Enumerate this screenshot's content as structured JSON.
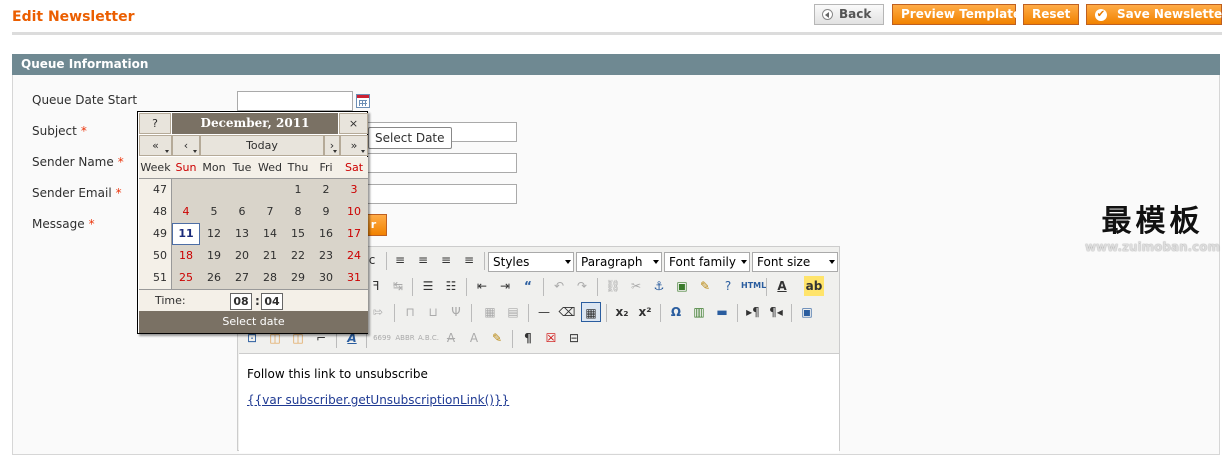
{
  "header": {
    "title": "Edit Newsletter",
    "back": "Back",
    "preview": "Preview Template",
    "reset": "Reset",
    "save": "Save Newsletter"
  },
  "section": {
    "title": "Queue Information"
  },
  "fields": {
    "queue_date_start": "Queue Date Start",
    "subject": "Subject",
    "sender_name": "Sender Name",
    "sender_email": "Sender Email",
    "message": "Message",
    "required_mark": "*"
  },
  "tooltip": "Select Date",
  "calendar": {
    "help": "?",
    "title": "December, 2011",
    "close": "×",
    "prev_year": "«",
    "prev_month": "‹",
    "today": "Today",
    "next_month": "›",
    "next_year": "»",
    "week_label": "Week",
    "days": [
      "Sun",
      "Mon",
      "Tue",
      "Wed",
      "Thu",
      "Fri",
      "Sat"
    ],
    "weeks": [
      {
        "num": "47",
        "days": [
          "",
          "",
          "",
          "",
          "1",
          "2",
          "3"
        ]
      },
      {
        "num": "48",
        "days": [
          "4",
          "5",
          "6",
          "7",
          "8",
          "9",
          "10"
        ]
      },
      {
        "num": "49",
        "days": [
          "11",
          "12",
          "13",
          "14",
          "15",
          "16",
          "17"
        ]
      },
      {
        "num": "50",
        "days": [
          "18",
          "19",
          "20",
          "21",
          "22",
          "23",
          "24"
        ]
      },
      {
        "num": "51",
        "days": [
          "25",
          "26",
          "27",
          "28",
          "29",
          "30",
          "31"
        ]
      }
    ],
    "today_day": "11",
    "time_label": "Time:",
    "hour": "08",
    "colon": ":",
    "minute": "04",
    "footer": "Select date"
  },
  "editor": {
    "styles": "Styles",
    "format": "Paragraph",
    "font_family": "Font family",
    "font_size": "Font size",
    "html_label": "HTML",
    "content_line1": "Follow this link to unsubscribe",
    "content_line2": "{{var subscriber.getUnsubscriptionLink()}}"
  },
  "watermark": {
    "cn": "最模板",
    "url": "www.zuimoban.com"
  }
}
